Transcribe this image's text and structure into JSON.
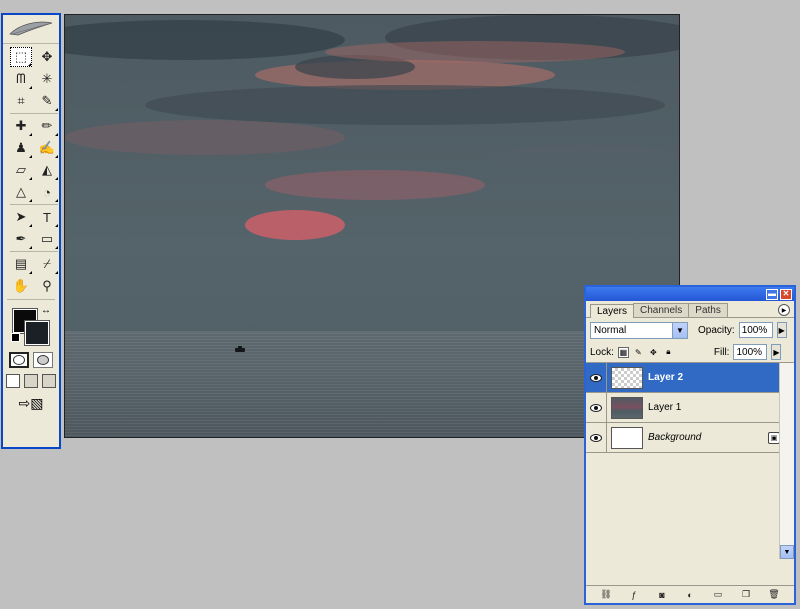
{
  "toolbox": {
    "tools": [
      {
        "name": "marquee-tool-icon",
        "glyph": "⬚",
        "active": true,
        "more": true
      },
      {
        "name": "move-tool-icon",
        "glyph": "✥",
        "active": false,
        "more": false
      },
      {
        "name": "lasso-tool-icon",
        "glyph": "ᗰ",
        "active": false,
        "more": true
      },
      {
        "name": "magic-wand-tool-icon",
        "glyph": "✳",
        "active": false,
        "more": false
      },
      {
        "name": "crop-tool-icon",
        "glyph": "⌗",
        "active": false,
        "more": false
      },
      {
        "name": "slice-tool-icon",
        "glyph": "✎",
        "active": false,
        "more": true
      },
      {
        "name": "healing-brush-tool-icon",
        "glyph": "✚",
        "active": false,
        "more": true
      },
      {
        "name": "brush-tool-icon",
        "glyph": "✏",
        "active": false,
        "more": true
      },
      {
        "name": "clone-stamp-tool-icon",
        "glyph": "♟",
        "active": false,
        "more": true
      },
      {
        "name": "history-brush-tool-icon",
        "glyph": "✍",
        "active": false,
        "more": true
      },
      {
        "name": "eraser-tool-icon",
        "glyph": "▱",
        "active": false,
        "more": true
      },
      {
        "name": "paint-bucket-tool-icon",
        "glyph": "◭",
        "active": false,
        "more": true
      },
      {
        "name": "blur-tool-icon",
        "glyph": "△",
        "active": false,
        "more": true
      },
      {
        "name": "dodge-tool-icon",
        "glyph": "◔",
        "active": false,
        "more": true
      },
      {
        "name": "path-selection-tool-icon",
        "glyph": "➤",
        "active": false,
        "more": true
      },
      {
        "name": "type-tool-icon",
        "glyph": "T",
        "active": false,
        "more": true
      },
      {
        "name": "pen-tool-icon",
        "glyph": "✒",
        "active": false,
        "more": true
      },
      {
        "name": "rectangle-tool-icon",
        "glyph": "▭",
        "active": false,
        "more": true
      },
      {
        "name": "notes-tool-icon",
        "glyph": "▤",
        "active": false,
        "more": true
      },
      {
        "name": "eyedropper-tool-icon",
        "glyph": "⌿",
        "active": false,
        "more": true
      },
      {
        "name": "hand-tool-icon",
        "glyph": "✋",
        "active": false,
        "more": false
      },
      {
        "name": "zoom-tool-icon",
        "glyph": "⚲",
        "active": false,
        "more": false
      }
    ],
    "foreground_color": "#0a0a0a",
    "background_color": "#1b2026"
  },
  "layers_panel": {
    "tabs": [
      "Layers",
      "Channels",
      "Paths"
    ],
    "blend_mode": "Normal",
    "opacity_label": "Opacity:",
    "opacity_value": "100%",
    "lock_label": "Lock:",
    "fill_label": "Fill:",
    "fill_value": "100%",
    "layers": [
      {
        "name": "Layer 2",
        "thumb": "checker",
        "selected": true,
        "style": "bold",
        "locked": false
      },
      {
        "name": "Layer 1",
        "thumb": "photo",
        "selected": false,
        "style": "normal",
        "locked": false
      },
      {
        "name": "Background",
        "thumb": "white",
        "selected": false,
        "style": "italic",
        "locked": true
      }
    ]
  },
  "colors": {
    "selection": "#316ac5",
    "titlebar": "#2456d6",
    "panel_bg": "#ece9d8"
  }
}
